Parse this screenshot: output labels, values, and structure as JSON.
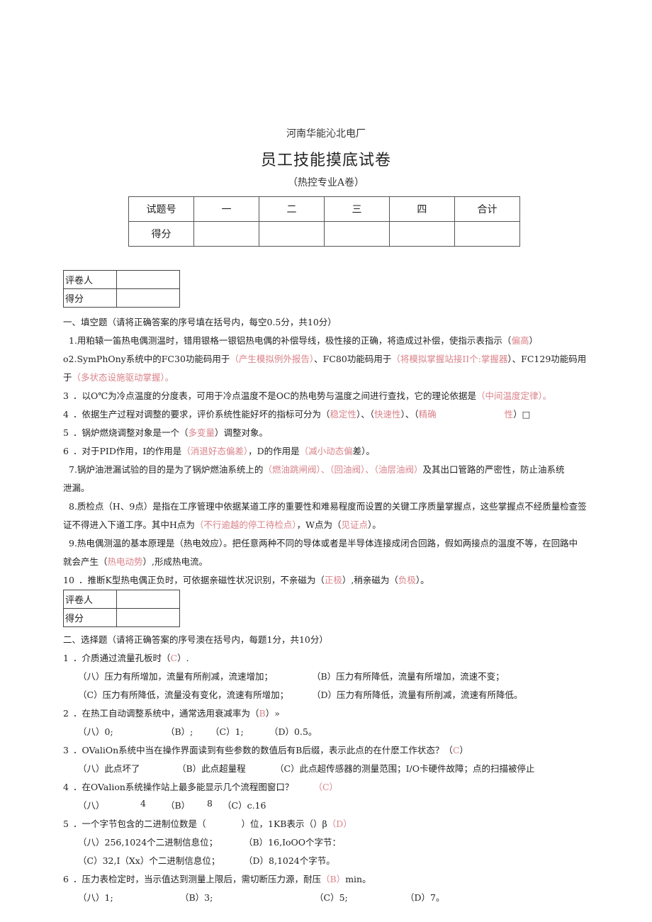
{
  "header": {
    "organization": "河南华能沁北电厂",
    "title": "员工技能摸底试卷",
    "subtitle": "（热控专业A卷）"
  },
  "score_table": {
    "row1": [
      "试题号",
      "一",
      "二",
      "三",
      "四",
      "合计"
    ],
    "row2": [
      "得分",
      "",
      "",
      "",
      "",
      ""
    ]
  },
  "grader_box": {
    "grader_label": "评卷人",
    "score_label": "得分"
  },
  "colors": {
    "answer": "#d9838a",
    "text": "#222222"
  },
  "section1": {
    "heading": "一、填空题（请将正确答案的序号填在括号内，每空0.5分，共10分）",
    "q1": {
      "text": "1.用粕辕一笛热电偶测温时，错用银格一银铝热电偶的补偿导线，极性接的正确，将造成过补偿，使指示表指示（",
      "ans": "偏高",
      "tail": "）"
    },
    "q2": {
      "a": "o2.SymPhOny系统中的FC30功能码用于",
      "ans1": "（产生模拟例外报告）",
      "b": "、FC80功能码用于",
      "ans2": "（将模拟掌握站接II个:掌握器",
      "c": "）、FC129功能码用",
      "d": "于",
      "ans3": "（多状态设施驱动掌握）。"
    },
    "q3": {
      "num": "3",
      "text": "．以O℃为冷点温度的分度表，可用于冷点温度不是OC的热电势与温度之间进行查找，它的理论依据是",
      "ans": "（中间温度定律）。"
    },
    "q4": {
      "num": "4",
      "text": "．依据生产过程对调整的要求，评价系统性能好坏的指标可分为（",
      "ans1": "稳定性",
      "sep1": "）、（",
      "ans2": "快速性",
      "sep2": "）、（",
      "ans3": "精确",
      "ans3b": "性",
      "tail": "）□"
    },
    "q5": {
      "num": "5",
      "text": "．锅炉燃烧调整对象是一个（",
      "ans": "多变量",
      "tail": "）调整对象。"
    },
    "q6": {
      "num": "6",
      "text": "．对于PID作用，I的作用是",
      "ans1": "（消退好态偏差）",
      "mid": "，D的作用是",
      "ans2": "（减小动态偏",
      "tail": "差）。"
    },
    "q7": {
      "text": "7.锅炉油泄漏试验的目的是为了锅炉燃油系统上的",
      "ans1": "（燃油跳闸阀）、（回油阀）、（油层油阀）",
      "tail": "及其出口管路的严密性，防止油系统",
      "cont": "泄漏。"
    },
    "q8": {
      "text": "8.质检点（H、9点）是指在工序管理中依据某道工序的重要性和难易程度而设置的关键工序质量掌握点，这些掌握点不经质量检查签",
      "cont": "证不得进入下道工序。其中H点为",
      "ans1": "（不行逾越的停工待检点）",
      "mid": "，W点为（",
      "ans2": "见证点",
      "tail": "）。"
    },
    "q9": {
      "text": "9.热电偶测温的基本原理是（热电效应）。把任意两种不同的导体或者是半导体连接成闭合回路，假如两接点的温度不等，在回路中",
      "cont": "就会产生（",
      "ans": "热电动势",
      "tail": "）,形成热电流。"
    },
    "q10": {
      "num": "10",
      "text": "．推断K型热电偶正负时，可依据亲磁性状况识别，不亲磁为（",
      "ans1": "正极",
      "mid": "）,稍亲磁为（",
      "ans2": "负极",
      "tail": "）。"
    }
  },
  "section2": {
    "heading": "二、选择题（请将正确答案的序号澳在括号内，每题1分，共10分）",
    "q1": {
      "num": "1",
      "text": "．介质通过流量孔板时（",
      "ans": "C",
      "tail": "）.",
      "opts": [
        "（八）压力有所增加，流量有所削减，流速增加；",
        "（B）压力有所降低，流量有所增加，流速不变；",
        "（C）压力有所降低，流量没有变化，流速有所增加；",
        "（D）压力有所降低，流量有所削减，流速有所降低。"
      ]
    },
    "q2": {
      "num": "2",
      "text": "．在热工自动调整系统中，通常选用衰减率为（",
      "ans": "B",
      "tail": "）»",
      "opts": [
        "（八）0;",
        "（B）;",
        "（C）1;",
        "（D）0.5。"
      ]
    },
    "q3": {
      "num": "3",
      "text": "．OValiOn系统中当在操作界面读到有些参数的数值后有B后缀，表示此点的在什麽工作状态？（",
      "ans": "C",
      "tail": "）",
      "opts": [
        "（八）此点坏了",
        "（B）此点超量程",
        "（C）此点超传感器的测量范围；I/O卡硬件故障；点的扫描被停止"
      ]
    },
    "q4": {
      "num": "4",
      "text": "．在OValion系统操作站上最多能显示几个流程图窗口？",
      "ans": "（C）",
      "opts": [
        "（八）",
        "4",
        "（B）",
        "8",
        "（C）c.16"
      ]
    },
    "q5": {
      "num": "5",
      "text": "．一个字节包含的二进制位数是（　　　　）位，1KB表示（）β",
      "ans": "（D）",
      "opts": [
        "（八）256,1024个二进制信息位；",
        "（B）16,IoOO个字节：",
        "（C）32,I（Xx）个二进制信息位；",
        "（D）8,1024个字节。"
      ]
    },
    "q6": {
      "num": "6",
      "text": "．压力表检定时，当示值达到测量上限后，需切断压力源，耐压",
      "ans": "（B）",
      "tail": "min。",
      "opts": [
        "（八）1;",
        "（B）3;",
        "（C）5;",
        "（D）7。"
      ]
    }
  }
}
